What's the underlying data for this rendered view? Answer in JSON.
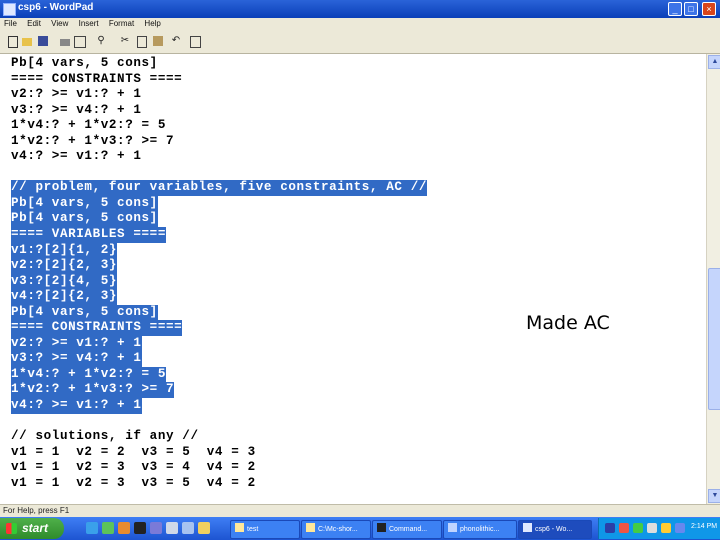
{
  "window": {
    "title": "csp6 - WordPad",
    "buttons": [
      "_",
      "□",
      "×"
    ]
  },
  "menu": [
    "File",
    "Edit",
    "View",
    "Insert",
    "Format",
    "Help"
  ],
  "toolbar_icons": [
    "new-icon",
    "open-icon",
    "save-icon",
    "print-icon",
    "print-preview-icon",
    "find-icon",
    "cut-icon",
    "copy-icon",
    "paste-icon",
    "undo-icon",
    "date-time-icon"
  ],
  "document": {
    "lines": [
      {
        "text": "Pb[4 vars, 5 cons]",
        "selected": false
      },
      {
        "text": "==== CONSTRAINTS ====",
        "selected": false
      },
      {
        "text": "v2:? >= v1:? + 1",
        "selected": false
      },
      {
        "text": "v3:? >= v4:? + 1",
        "selected": false
      },
      {
        "text": "1*v4:? + 1*v2:? = 5",
        "selected": false
      },
      {
        "text": "1*v2:? + 1*v3:? >= 7",
        "selected": false
      },
      {
        "text": "v4:? >= v1:? + 1",
        "selected": false
      },
      {
        "text": "",
        "selected": false
      },
      {
        "text": "// problem, four variables, five constraints, AC //",
        "selected": true
      },
      {
        "text": "Pb[4 vars, 5 cons]",
        "selected": true
      },
      {
        "text": "Pb[4 vars, 5 cons]",
        "selected": true
      },
      {
        "text": "==== VARIABLES ====",
        "selected": true
      },
      {
        "text": "v1:?[2]{1, 2}",
        "selected": true
      },
      {
        "text": "v2:?[2]{2, 3}",
        "selected": true
      },
      {
        "text": "v3:?[2]{4, 5}",
        "selected": true
      },
      {
        "text": "v4:?[2]{2, 3}",
        "selected": true
      },
      {
        "text": "Pb[4 vars, 5 cons]",
        "selected": true
      },
      {
        "text": "==== CONSTRAINTS ====",
        "selected": true
      },
      {
        "text": "v2:? >= v1:? + 1",
        "selected": true
      },
      {
        "text": "v3:? >= v4:? + 1",
        "selected": true
      },
      {
        "text": "1*v4:? + 1*v2:? = 5",
        "selected": true
      },
      {
        "text": "1*v2:? + 1*v3:? >= 7",
        "selected": true
      },
      {
        "text": "v4:? >= v1:? + 1",
        "selected": true
      },
      {
        "text": "",
        "selected": false
      },
      {
        "text": "// solutions, if any //",
        "selected": false
      },
      {
        "text": "v1 = 1  v2 = 2  v3 = 5  v4 = 3",
        "selected": false
      },
      {
        "text": "v1 = 1  v2 = 3  v3 = 4  v4 = 2",
        "selected": false
      },
      {
        "text": "v1 = 1  v2 = 3  v3 = 5  v4 = 2",
        "selected": false
      }
    ]
  },
  "annotation": "Made AC",
  "status": "For Help, press F1",
  "taskbar": {
    "start_label": "start",
    "tasks": [
      {
        "label": "test",
        "active": false
      },
      {
        "label": "C:\\Mc-shor...",
        "active": false
      },
      {
        "label": "Command...",
        "active": false
      },
      {
        "label": "phonolithic...",
        "active": false
      },
      {
        "label": "csp6 - Wo...",
        "active": true
      }
    ],
    "clock": "2:14 PM"
  },
  "colors": {
    "selection": "#316ac5",
    "titlebar": "#0a3fb8",
    "taskbar": "#245edb",
    "start": "#3c9a37"
  }
}
